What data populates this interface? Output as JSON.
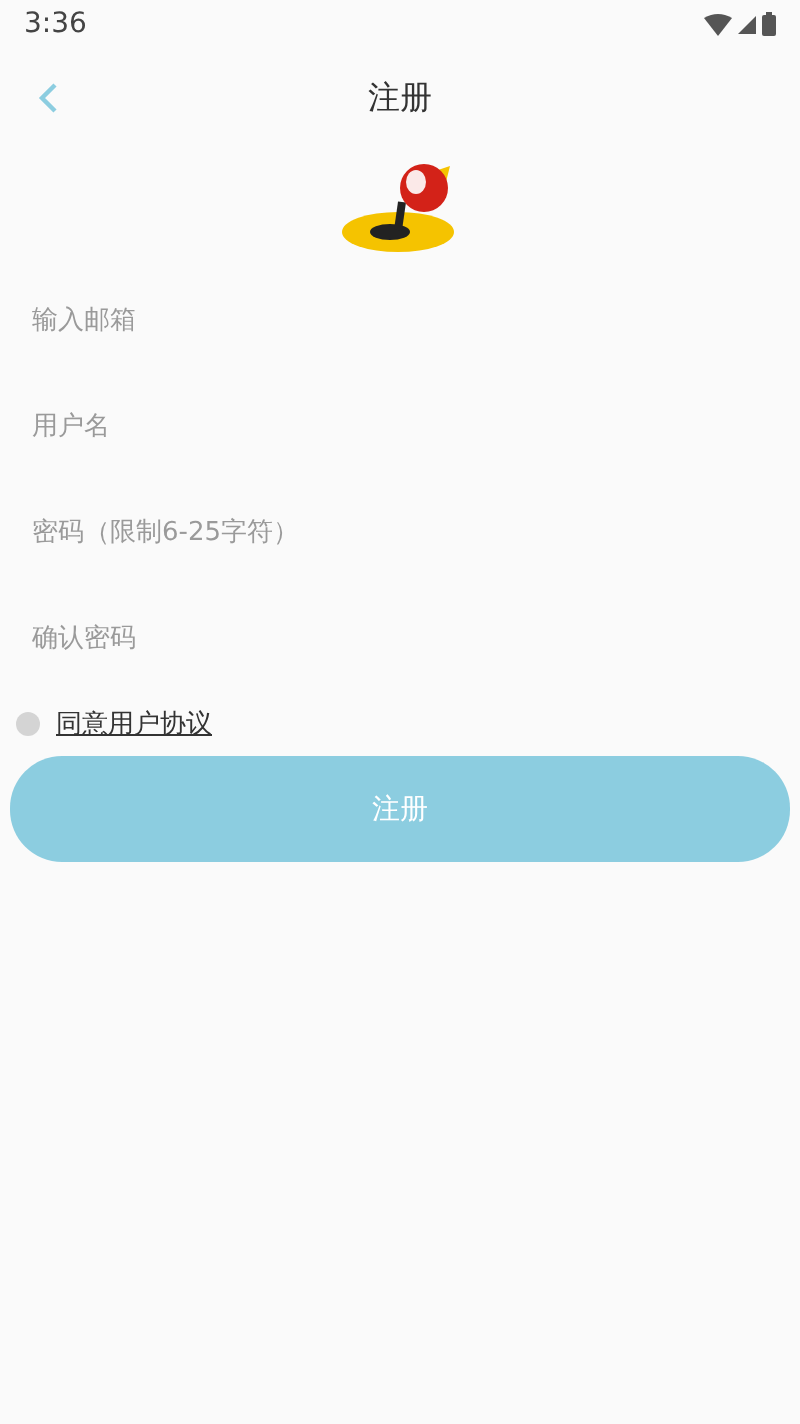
{
  "status_bar": {
    "time": "3:36"
  },
  "header": {
    "title": "注册"
  },
  "fields": [
    {
      "placeholder": "输入邮箱"
    },
    {
      "placeholder": "用户名"
    },
    {
      "placeholder": "密码（限制6-25字符）"
    },
    {
      "placeholder": "确认密码"
    }
  ],
  "agreement": {
    "label": "同意用户协议",
    "checked": false
  },
  "submit_button": {
    "label": "注册"
  }
}
